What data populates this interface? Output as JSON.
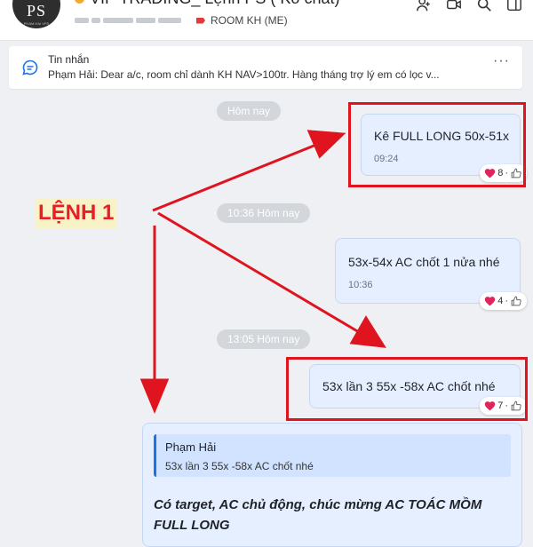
{
  "header": {
    "avatar_text": "PS",
    "avatar_subtext": "PHAM HAI VPS",
    "title": "VIP TRADING_ Lệnh PS ( Ko chat)",
    "tag_label": "ROOM KH (ME)",
    "tag_color": "#e23a3a",
    "icons": [
      "add-member-icon",
      "video-call-icon",
      "search-icon",
      "sidebar-toggle-icon"
    ]
  },
  "notice": {
    "title": "Tin nhắn",
    "text": "Phạm Hải: Dear a/c, room chỉ dành KH NAV>100tr. Hàng tháng trợ lý em có lọc v...",
    "more": "···"
  },
  "date_separators": [
    "Hôm nay",
    "10:36 Hôm nay",
    "13:05 Hôm nay"
  ],
  "messages": [
    {
      "text": "Kê FULL LONG 50x-51x",
      "time": "09:24",
      "reaction_count": "8"
    },
    {
      "text": "53x-54x AC chốt 1 nửa nhé",
      "time": "10:36",
      "reaction_count": "4"
    },
    {
      "text": "53x lần 3 55x -58x AC chốt nhé",
      "time": "",
      "reaction_count": "7"
    }
  ],
  "reaction_separator": "·",
  "annotation": {
    "label": "LỆNH 1",
    "color": "#e0141e"
  },
  "quoted_message": {
    "author": "Phạm Hải",
    "quoted_text": "53x lần 3 55x -58x AC chốt nhé",
    "body": "Có target, AC chủ động, chúc mừng AC TOÁC MỒM FULL LONG"
  },
  "colors": {
    "bubble": "#e5efff",
    "accent": "#1b74e4",
    "highlight_red": "#e0141e",
    "background": "#eef0f3"
  }
}
